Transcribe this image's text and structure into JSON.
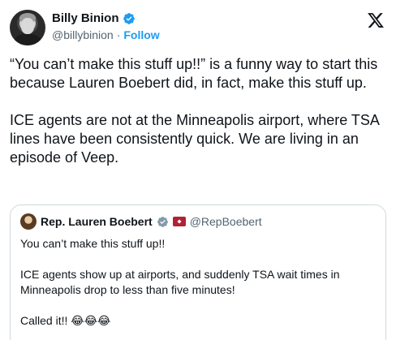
{
  "author": {
    "name": "Billy Binion",
    "handle": "@billybinion",
    "separator": "·",
    "follow_label": "Follow"
  },
  "icons": {
    "verified": "verified-badge-icon",
    "x_logo": "x-logo-icon",
    "quote_affiliation": "affiliation-badge-icon"
  },
  "colors": {
    "accent": "#1d9bf0",
    "text": "#0f1419",
    "muted": "#536471",
    "border": "#cfd9de"
  },
  "tweet": {
    "text": "“You can’t make this stuff up!!” is a funny way to start this because Lauren Boebert did, in fact, make this stuff up.\n\nICE agents are not at the Minneapolis airport, where TSA lines have been consistently quick. We are living in an episode of Veep."
  },
  "quote": {
    "name": "Rep. Lauren Boebert",
    "handle": "@RepBoebert",
    "text": "You can’t make this stuff up!!\n\nICE agents show up at airports, and suddenly TSA wait times in Minneapolis drop to less than five minutes!\n\nCalled it!! 😂😂😂"
  }
}
